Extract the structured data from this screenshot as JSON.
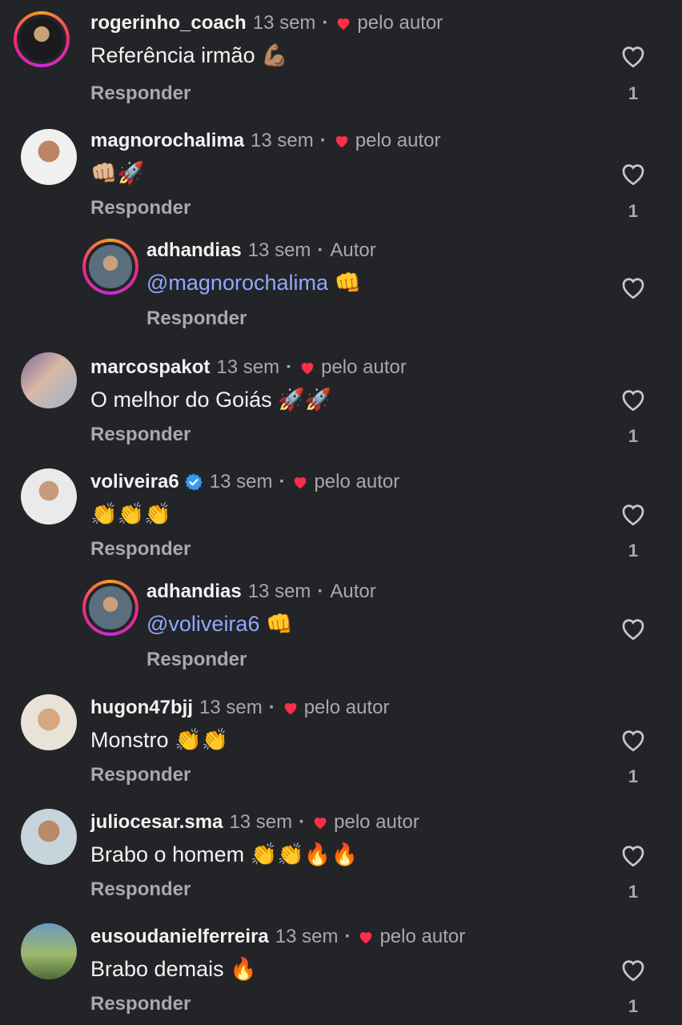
{
  "colors": {
    "background": "#232427",
    "text_primary": "#f2f2f2",
    "text_secondary": "#a8a8ad",
    "mention": "#8fa9ff",
    "heart_red": "#ff2d4a",
    "verified_blue": "#3897f0"
  },
  "comments": [
    {
      "username": "rogerinho_coach",
      "time": "13 sem",
      "dot": "·",
      "author_liked": "pelo autor",
      "text": "Referência irmão 💪🏽",
      "reply_label": "Responder",
      "likes": "1",
      "story_ring": true,
      "verified": false,
      "icons": [
        "avatar",
        "heart-icon",
        "like-outline-icon"
      ]
    },
    {
      "username": "magnorochalima",
      "time": "13 sem",
      "dot": "·",
      "author_liked": "pelo autor",
      "text": "👊🏼🚀",
      "reply_label": "Responder",
      "likes": "1",
      "story_ring": false,
      "verified": false,
      "icons": [
        "avatar",
        "heart-icon",
        "like-outline-icon"
      ]
    },
    {
      "username": "adhandias",
      "time": "13 sem",
      "dot": "·",
      "author_tag": "Autor",
      "mention": "@magnorochalima",
      "text_after": " 👊",
      "reply_label": "Responder",
      "is_reply": true,
      "story_ring": true,
      "icons": [
        "avatar",
        "like-outline-icon"
      ]
    },
    {
      "username": "marcospakot",
      "time": "13 sem",
      "dot": "·",
      "author_liked": "pelo autor",
      "text": "O melhor do Goiás 🚀🚀",
      "reply_label": "Responder",
      "likes": "1",
      "story_ring": false,
      "verified": false,
      "icons": [
        "avatar",
        "heart-icon",
        "like-outline-icon"
      ]
    },
    {
      "username": "voliveira6",
      "time": "13 sem",
      "dot": "·",
      "author_liked": "pelo autor",
      "text": "👏👏👏",
      "reply_label": "Responder",
      "likes": "1",
      "story_ring": false,
      "verified": true,
      "icons": [
        "avatar",
        "verified-badge-icon",
        "heart-icon",
        "like-outline-icon"
      ]
    },
    {
      "username": "adhandias",
      "time": "13 sem",
      "dot": "·",
      "author_tag": "Autor",
      "mention": "@voliveira6",
      "text_after": " 👊",
      "reply_label": "Responder",
      "is_reply": true,
      "story_ring": true,
      "icons": [
        "avatar",
        "like-outline-icon"
      ]
    },
    {
      "username": "hugon47bjj",
      "time": "13 sem",
      "dot": "·",
      "author_liked": "pelo autor",
      "text": "Monstro 👏👏",
      "reply_label": "Responder",
      "likes": "1",
      "story_ring": false,
      "verified": false,
      "icons": [
        "avatar",
        "heart-icon",
        "like-outline-icon"
      ]
    },
    {
      "username": "juliocesar.sma",
      "time": "13 sem",
      "dot": "·",
      "author_liked": "pelo autor",
      "text": "Brabo o homem 👏👏🔥🔥",
      "reply_label": "Responder",
      "likes": "1",
      "story_ring": false,
      "verified": false,
      "icons": [
        "avatar",
        "heart-icon",
        "like-outline-icon"
      ]
    },
    {
      "username": "eusoudanielferreira",
      "time": "13 sem",
      "dot": "·",
      "author_liked": "pelo autor",
      "text": "Brabo demais 🔥",
      "reply_label": "Responder",
      "likes": "1",
      "story_ring": false,
      "verified": false,
      "icons": [
        "avatar",
        "heart-icon",
        "like-outline-icon"
      ]
    }
  ]
}
